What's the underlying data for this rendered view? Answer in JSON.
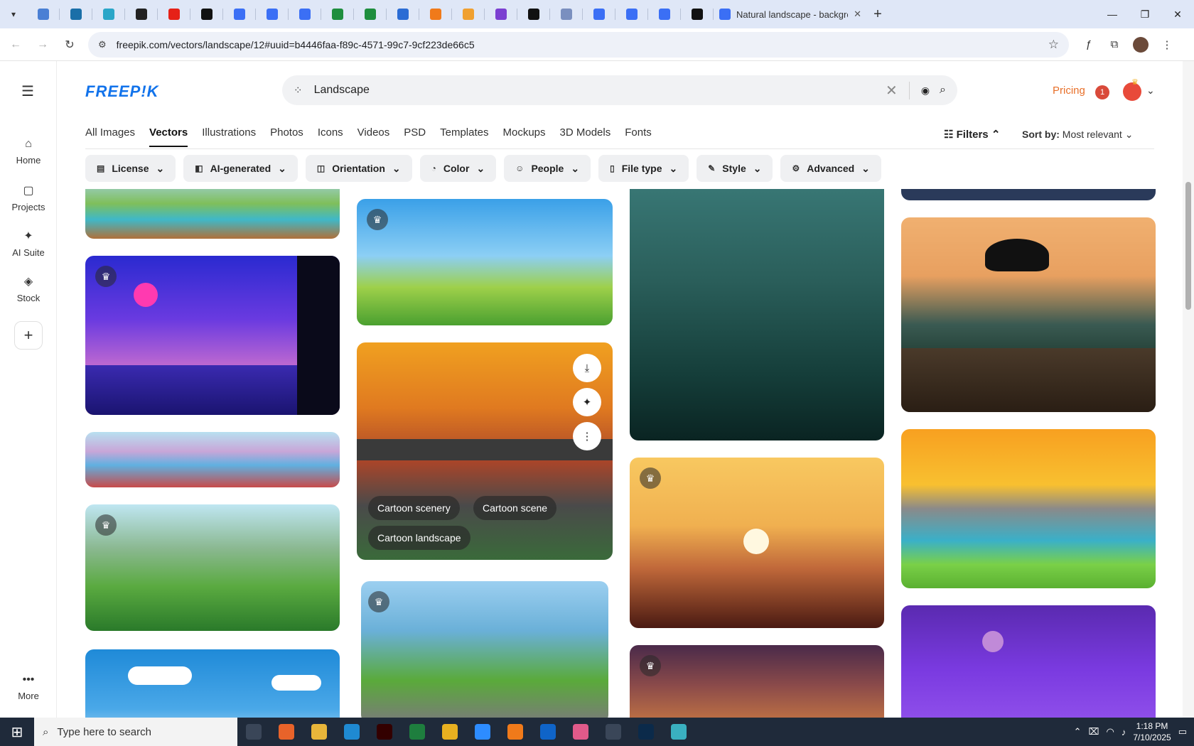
{
  "browser": {
    "pinned_tabs": [
      {
        "icon": "globe-icon",
        "color": "#4a7fd4"
      },
      {
        "icon": "wp-icon",
        "color": "#1a6fa8"
      },
      {
        "icon": "play-blue-icon",
        "color": "#2aa6c8"
      },
      {
        "icon": "openai-icon",
        "color": "#222222"
      },
      {
        "icon": "youtube-icon",
        "color": "#e62117"
      },
      {
        "icon": "bolt-icon",
        "color": "#111111"
      },
      {
        "icon": "docs-icon",
        "color": "#3b6ff5"
      },
      {
        "icon": "docs-icon",
        "color": "#3b6ff5"
      },
      {
        "icon": "docs-icon",
        "color": "#3b6ff5"
      },
      {
        "icon": "sheets-icon",
        "color": "#1e8e3e"
      },
      {
        "icon": "sheets-icon",
        "color": "#1e8e3e"
      },
      {
        "icon": "word-icon",
        "color": "#2b6cd4"
      },
      {
        "icon": "xampp-icon",
        "color": "#f07a1a"
      },
      {
        "icon": "vee-icon",
        "color": "#f0a030"
      },
      {
        "icon": "brackets-icon",
        "color": "#7b3fd1"
      },
      {
        "icon": "a-icon",
        "color": "#111111"
      },
      {
        "icon": "grid-icon",
        "color": "#7a8fbf"
      },
      {
        "icon": "forms-icon",
        "color": "#3b6ff5"
      },
      {
        "icon": "forms-icon",
        "color": "#3b6ff5"
      },
      {
        "icon": "forms-icon",
        "color": "#3b6ff5"
      },
      {
        "icon": "m-icon",
        "color": "#111111"
      }
    ],
    "active_tab_title": "Natural landscape - backgroun",
    "url": "freepik.com/vectors/landscape/12#uuid=b4446faa-f89c-4571-99c7-9cf223de66c5"
  },
  "rail": {
    "items": [
      {
        "label": "Home",
        "icon": "home-icon"
      },
      {
        "label": "Projects",
        "icon": "projects-icon"
      },
      {
        "label": "AI Suite",
        "icon": "sparkle-icon"
      },
      {
        "label": "Stock",
        "icon": "stock-icon"
      }
    ],
    "more_label": "More"
  },
  "header": {
    "logo": "FREEP!K",
    "search_query": "Landscape",
    "pricing_label": "Pricing",
    "notification_count": "1"
  },
  "categories": [
    "All Images",
    "Vectors",
    "Illustrations",
    "Photos",
    "Icons",
    "Videos",
    "PSD",
    "Templates",
    "Mockups",
    "3D Models",
    "Fonts"
  ],
  "active_category": "Vectors",
  "filters_label": "Filters",
  "sort": {
    "label": "Sort by:",
    "value": "Most relevant"
  },
  "filter_chips": [
    {
      "label": "License",
      "icon": "license-icon"
    },
    {
      "label": "AI-generated",
      "icon": "ai-icon"
    },
    {
      "label": "Orientation",
      "icon": "orientation-icon"
    },
    {
      "label": "Color",
      "icon": "palette-icon"
    },
    {
      "label": "People",
      "icon": "people-icon"
    },
    {
      "label": "File type",
      "icon": "file-icon"
    },
    {
      "label": "Style",
      "icon": "brush-icon"
    },
    {
      "label": "Advanced",
      "icon": "gear-icon"
    }
  ],
  "hovered_card_tags": [
    "Cartoon scenery",
    "Cartoon scene",
    "Cartoon landscape"
  ],
  "taskbar": {
    "search_placeholder": "Type here to search",
    "time": "1:18 PM",
    "date": "7/10/2025",
    "apps": [
      {
        "icon": "task-view-icon",
        "color": "#3a4658"
      },
      {
        "icon": "firefox-icon",
        "color": "#e8632a"
      },
      {
        "icon": "folder-icon",
        "color": "#e8b63a"
      },
      {
        "icon": "vscode-icon",
        "color": "#1f8ad2"
      },
      {
        "icon": "illustrator-icon",
        "color": "#330000"
      },
      {
        "icon": "excel-icon",
        "color": "#1e7e3e"
      },
      {
        "icon": "chrome-icon",
        "color": "#e8b020"
      },
      {
        "icon": "zoom-icon",
        "color": "#2d8cff"
      },
      {
        "icon": "xampp-icon",
        "color": "#f07a1a"
      },
      {
        "icon": "outlook-icon",
        "color": "#0f64c8"
      },
      {
        "icon": "photos-icon",
        "color": "#e05a8a"
      },
      {
        "icon": "pen-icon",
        "color": "#3a4658"
      },
      {
        "icon": "photoshop-icon",
        "color": "#0b2a4a"
      },
      {
        "icon": "app-icon",
        "color": "#3ab0c0"
      }
    ]
  }
}
